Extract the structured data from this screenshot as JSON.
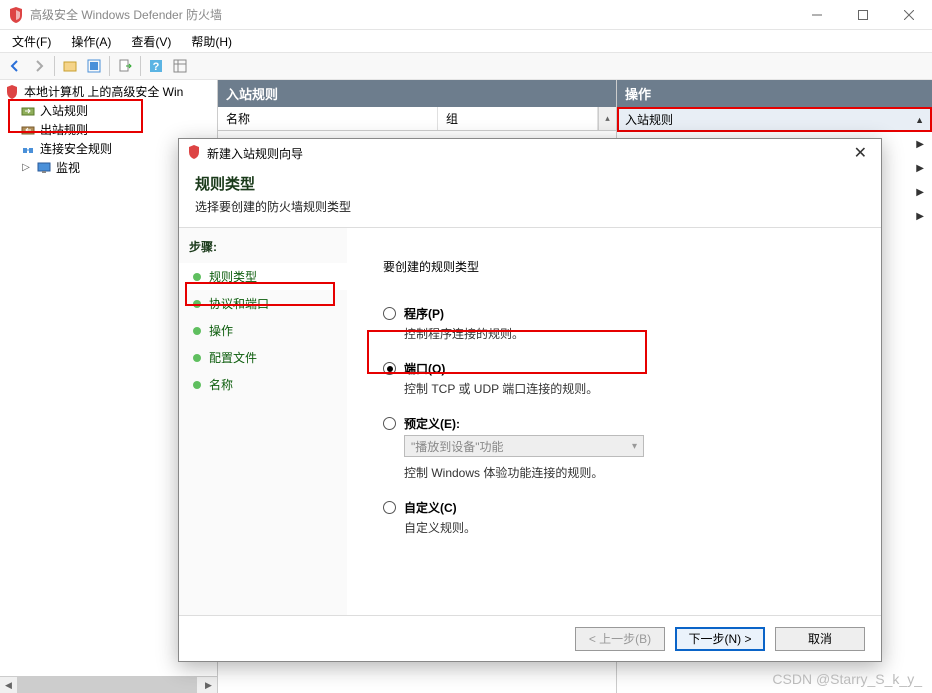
{
  "titlebar": {
    "title": "高级安全 Windows Defender 防火墙"
  },
  "win_controls": {
    "min": "—",
    "max": "☐",
    "close": "✕"
  },
  "menu": [
    "文件(F)",
    "操作(A)",
    "查看(V)",
    "帮助(H)"
  ],
  "tree": {
    "root": "本地计算机 上的高级安全 Win",
    "items": [
      "入站规则",
      "出站规则",
      "连接安全规则",
      "监视"
    ]
  },
  "center": {
    "header": "入站规则",
    "col_name": "名称",
    "col_group": "组"
  },
  "right": {
    "header": "操作",
    "section": "入站规则"
  },
  "wizard": {
    "title": "新建入站规则向导",
    "heading": "规则类型",
    "subtitle": "选择要创建的防火墙规则类型",
    "steps_title": "步骤:",
    "steps": [
      "规则类型",
      "协议和端口",
      "操作",
      "配置文件",
      "名称"
    ],
    "question": "要创建的规则类型",
    "options": {
      "program": {
        "label": "程序(P)",
        "desc": "控制程序连接的规则。"
      },
      "port": {
        "label": "端口(O)",
        "desc": "控制 TCP 或 UDP 端口连接的规则。"
      },
      "predefined": {
        "label": "预定义(E):",
        "select": "\"播放到设备\"功能",
        "desc": "控制 Windows 体验功能连接的规则。"
      },
      "custom": {
        "label": "自定义(C)",
        "desc": "自定义规则。"
      }
    },
    "buttons": {
      "back": "< 上一步(B)",
      "next": "下一步(N) >",
      "cancel": "取消"
    }
  },
  "watermark": "CSDN @Starry_S_k_y_"
}
